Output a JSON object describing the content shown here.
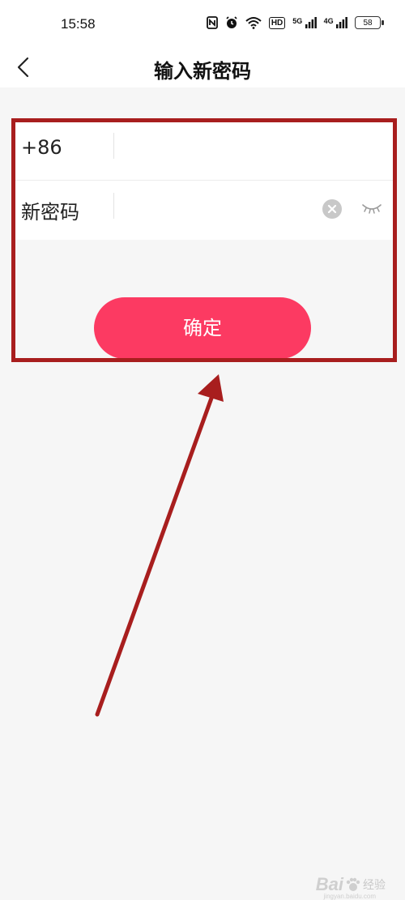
{
  "status_bar": {
    "time": "15:58",
    "icons": [
      "nfc-icon",
      "alarm-icon",
      "wifi-icon",
      "hd-icon",
      "signal-5g-icon",
      "signal-4g-icon"
    ],
    "hd_label": "HD",
    "net1_label": "5G",
    "net2_label": "4G",
    "battery_level": "58"
  },
  "nav": {
    "back_icon": "chevron-left-icon",
    "title": "输入新密码"
  },
  "form": {
    "phone_prefix": "+86",
    "phone_value": "",
    "password_label": "新密码",
    "password_value": "",
    "clear_icon": "clear-icon",
    "visibility_icon": "eye-closed-icon"
  },
  "confirm_label": "确定",
  "colors": {
    "accent": "#fc3a62",
    "annotation": "#a81e1e",
    "background": "#f6f6f6"
  },
  "watermark": {
    "logo": "Bai",
    "text": "经验",
    "url": "jingyan.baidu.com"
  }
}
